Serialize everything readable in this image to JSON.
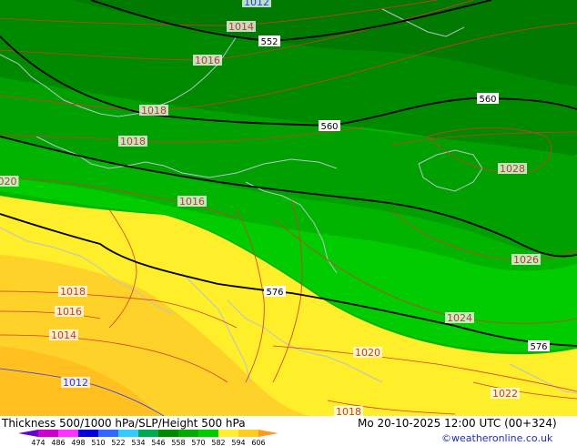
{
  "map": {
    "slp_labels": [
      {
        "text": "1012",
        "color": "#1a3cff"
      },
      {
        "text": "1014",
        "color": "#c0392b"
      },
      {
        "text": "1016",
        "color": "#c0392b"
      },
      {
        "text": "1018",
        "color": "#c0392b"
      },
      {
        "text": "1018",
        "color": "#c0392b"
      },
      {
        "text": "020",
        "color": "#c0392b"
      },
      {
        "text": "1016",
        "color": "#c0392b"
      },
      {
        "text": "1028",
        "color": "#c0392b"
      },
      {
        "text": "1026",
        "color": "#c0392b"
      },
      {
        "text": "1024",
        "color": "#c0392b"
      },
      {
        "text": "1018",
        "color": "#c0392b"
      },
      {
        "text": "1016",
        "color": "#c0392b"
      },
      {
        "text": "1014",
        "color": "#c0392b"
      },
      {
        "text": "1012",
        "color": "#1a3cff"
      },
      {
        "text": "1020",
        "color": "#c0392b"
      },
      {
        "text": "1022",
        "color": "#c0392b"
      },
      {
        "text": "1018",
        "color": "#c0392b"
      }
    ],
    "thickness_labels": [
      "552",
      "560",
      "560",
      "576",
      "576"
    ]
  },
  "legend": {
    "colors": [
      "#6600cc",
      "#cc00cc",
      "#ff33ff",
      "#0000dd",
      "#3366ff",
      "#33ccff",
      "#00aa55",
      "#008800",
      "#00aa00",
      "#00cc00",
      "#ffee33",
      "#ffcc22",
      "#ff9922"
    ],
    "ticks": [
      "474",
      "486",
      "498",
      "510",
      "522",
      "534",
      "546",
      "558",
      "570",
      "582",
      "594",
      "606"
    ]
  },
  "footer": {
    "title": "Thickness 500/1000 hPa/SLP/Height 500 hPa",
    "datetime": "Mo 20-10-2025 12:00 UTC (00+324)",
    "credit": "©weatheronline.co.uk"
  }
}
